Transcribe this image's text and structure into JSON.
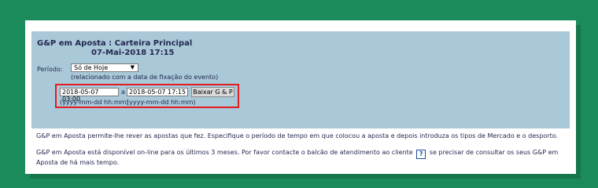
{
  "header": {
    "title": "G&P em Aposta : Carteira Principal",
    "datetime": "07-Mai-2018 17:15"
  },
  "period": {
    "label": "Período:",
    "selected": "Só de Hoje",
    "note": "(relacionado com a data de fixação do evento)"
  },
  "range": {
    "start_value": "2018-05-07 03:00",
    "separator": "a",
    "end_value": "2018-05-07 17:15",
    "start_format": "(yyyy-mm-dd hh:mm)",
    "end_format": "(yyyy-mm-dd hh:mm)",
    "download_label": "Baixar G & P"
  },
  "info": {
    "para1": "G&P em Aposta permite-lhe rever as apostas que fez. Especifique o período de tempo em que colocou a aposta e depois introduza os tipos de Mercado e o desporto.",
    "para2_before": "G&P em Aposta está disponível on-line para os últimos 3 meses. Por favor contacte o balcão de atendimento ao cliente",
    "help_label": "?",
    "para2_after": "se precisar de consultar os seus G&P em Aposta de há mais tempo."
  },
  "colors": {
    "background": "#1b8b5b",
    "header_box": "#a9c8d8",
    "highlight_border": "#e31b23",
    "text": "#23284f"
  }
}
